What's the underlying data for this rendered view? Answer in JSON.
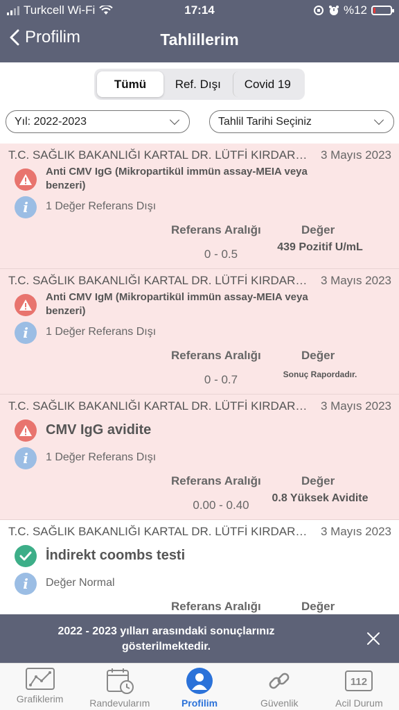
{
  "status_bar": {
    "carrier": "Turkcell Wi-Fi",
    "time": "17:14",
    "battery": "%12"
  },
  "nav": {
    "back_label": "Profilim",
    "title": "Tahlillerim"
  },
  "segments": [
    "Tümü",
    "Ref. Dışı",
    "Covid 19"
  ],
  "filters": {
    "year": "Yıl: 2022-2023",
    "date": "Tahlil Tarihi Seçiniz"
  },
  "columns": {
    "ref": "Referans Aralığı",
    "value": "Değer"
  },
  "results": [
    {
      "hospital": "T.C. SAĞLIK BAKANLIĞI KARTAL DR. LÜTFİ KIRDAR ŞEHİR HASTANESİ",
      "date": "3 Mayıs 2023",
      "test": "Anti CMV IgG (Mikropartikül immün assay-MEIA veya benzeri)",
      "note": "1 Değer Referans Dışı",
      "ref": "0 - 0.5",
      "value": "439 Pozitif U/mL"
    },
    {
      "hospital": "T.C. SAĞLIK BAKANLIĞI KARTAL DR. LÜTFİ KIRDAR ŞEHİR HASTANESİ",
      "date": "3 Mayıs 2023",
      "test": "Anti CMV IgM (Mikropartikül immün assay-MEIA veya benzeri)",
      "note": "1 Değer Referans Dışı",
      "ref": "0 - 0.7",
      "value": "Sonuç Rapordadır."
    },
    {
      "hospital": "T.C. SAĞLIK BAKANLIĞI KARTAL DR. LÜTFİ KIRDAR ŞEHİR HASTANESİ",
      "date": "3 Mayıs 2023",
      "test": "CMV IgG avidite",
      "note": "1 Değer Referans Dışı",
      "ref": "0.00 - 0.40",
      "value": "0.8 Yüksek Avidite"
    },
    {
      "hospital": "T.C. SAĞLIK BAKANLIĞI KARTAL DR. LÜTFİ KIRDAR ŞEHİR HASTANESİ",
      "date": "3 Mayıs 2023",
      "test": "İndirekt coombs testi",
      "note": "Değer Normal"
    }
  ],
  "toast": {
    "message": "2022 - 2023 yılları arasındaki sonuçlarınız gösterilmektedir."
  },
  "tabs": [
    "Grafiklerim",
    "Randevularım",
    "Profilim",
    "Güvenlik",
    "Acil Durum"
  ],
  "emergency_number": "112",
  "info_glyph": "i",
  "colors": {
    "header": "#5d6277",
    "accent": "#2b72d9",
    "alert_bg": "#fbe6e6",
    "warning": "#e8746e",
    "success": "#3dae88",
    "info": "#9bbde4"
  },
  "icons": [
    "chevron-left-icon",
    "wifi-icon",
    "alarm-icon",
    "chevron-down-icon",
    "warning-icon",
    "check-icon",
    "info-icon",
    "close-icon",
    "chart-icon",
    "calendar-icon",
    "profile-icon",
    "link-icon",
    "emergency-icon"
  ]
}
